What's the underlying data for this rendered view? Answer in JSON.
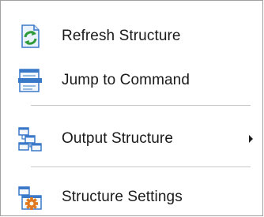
{
  "context_menu": {
    "items": [
      {
        "label": "Refresh Structure",
        "icon": "refresh-structure-icon"
      },
      {
        "label": "Jump to Command",
        "icon": "jump-to-command-icon"
      },
      {
        "label": "Output Structure",
        "icon": "output-structure-icon",
        "has_submenu": true
      },
      {
        "label": "Structure Settings",
        "icon": "structure-settings-icon"
      }
    ]
  },
  "colors": {
    "text": "#1a1a1a",
    "separator": "#c8c8c8",
    "border": "#a0a0a0",
    "icon_blue": "#3a78c8",
    "icon_green": "#2e9a3a",
    "icon_orange": "#e07820"
  }
}
